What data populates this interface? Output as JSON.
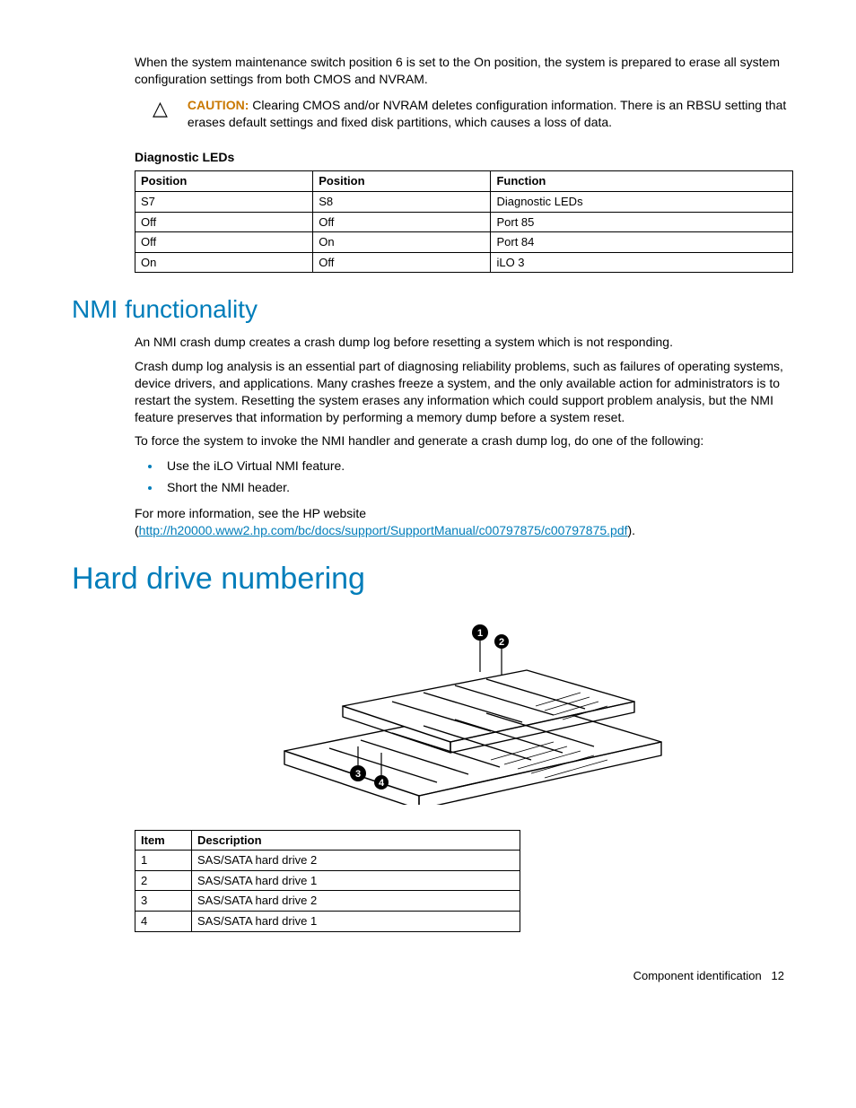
{
  "intro": "When the system maintenance switch position 6 is set to the On position, the system is prepared to erase all system configuration settings from both CMOS and NVRAM.",
  "caution": {
    "label": "CAUTION:",
    "text": "  Clearing CMOS and/or NVRAM deletes configuration information. There is an RBSU setting that erases default settings and fixed disk partitions, which causes a loss of data."
  },
  "diag_heading": "Diagnostic LEDs",
  "diag_table": {
    "headers": [
      "Position",
      "Position",
      "Function"
    ],
    "rows": [
      [
        "S7",
        "S8",
        "Diagnostic LEDs"
      ],
      [
        "Off",
        "Off",
        "Port 85"
      ],
      [
        "Off",
        "On",
        "Port 84"
      ],
      [
        "On",
        "Off",
        "iLO 3"
      ]
    ]
  },
  "nmi": {
    "title": "NMI functionality",
    "p1": "An NMI crash dump creates a crash dump log before resetting a system which is not responding.",
    "p2": "Crash dump log analysis is an essential part of diagnosing reliability problems, such as failures of operating systems, device drivers, and applications. Many crashes freeze a system, and the only available action for administrators is to restart the system. Resetting the system erases any information which could support problem analysis, but the NMI feature preserves that information by performing a memory dump before a system reset.",
    "p3": "To force the system to invoke the NMI handler and generate a crash dump log, do one of the following:",
    "bullets": [
      "Use the iLO Virtual NMI feature.",
      "Short the NMI header."
    ],
    "p4_pre": "For more information, see the HP website (",
    "p4_link": "http://h20000.www2.hp.com/bc/docs/support/SupportManual/c00797875/c00797875.pdf",
    "p4_post": ")."
  },
  "hdd": {
    "title": "Hard drive numbering",
    "table": {
      "headers": [
        "Item",
        "Description"
      ],
      "rows": [
        [
          "1",
          "SAS/SATA hard drive 2"
        ],
        [
          "2",
          "SAS/SATA hard drive 1"
        ],
        [
          "3",
          "SAS/SATA hard drive 2"
        ],
        [
          "4",
          "SAS/SATA hard drive 1"
        ]
      ]
    }
  },
  "footer": {
    "section": "Component identification",
    "page": "12"
  }
}
